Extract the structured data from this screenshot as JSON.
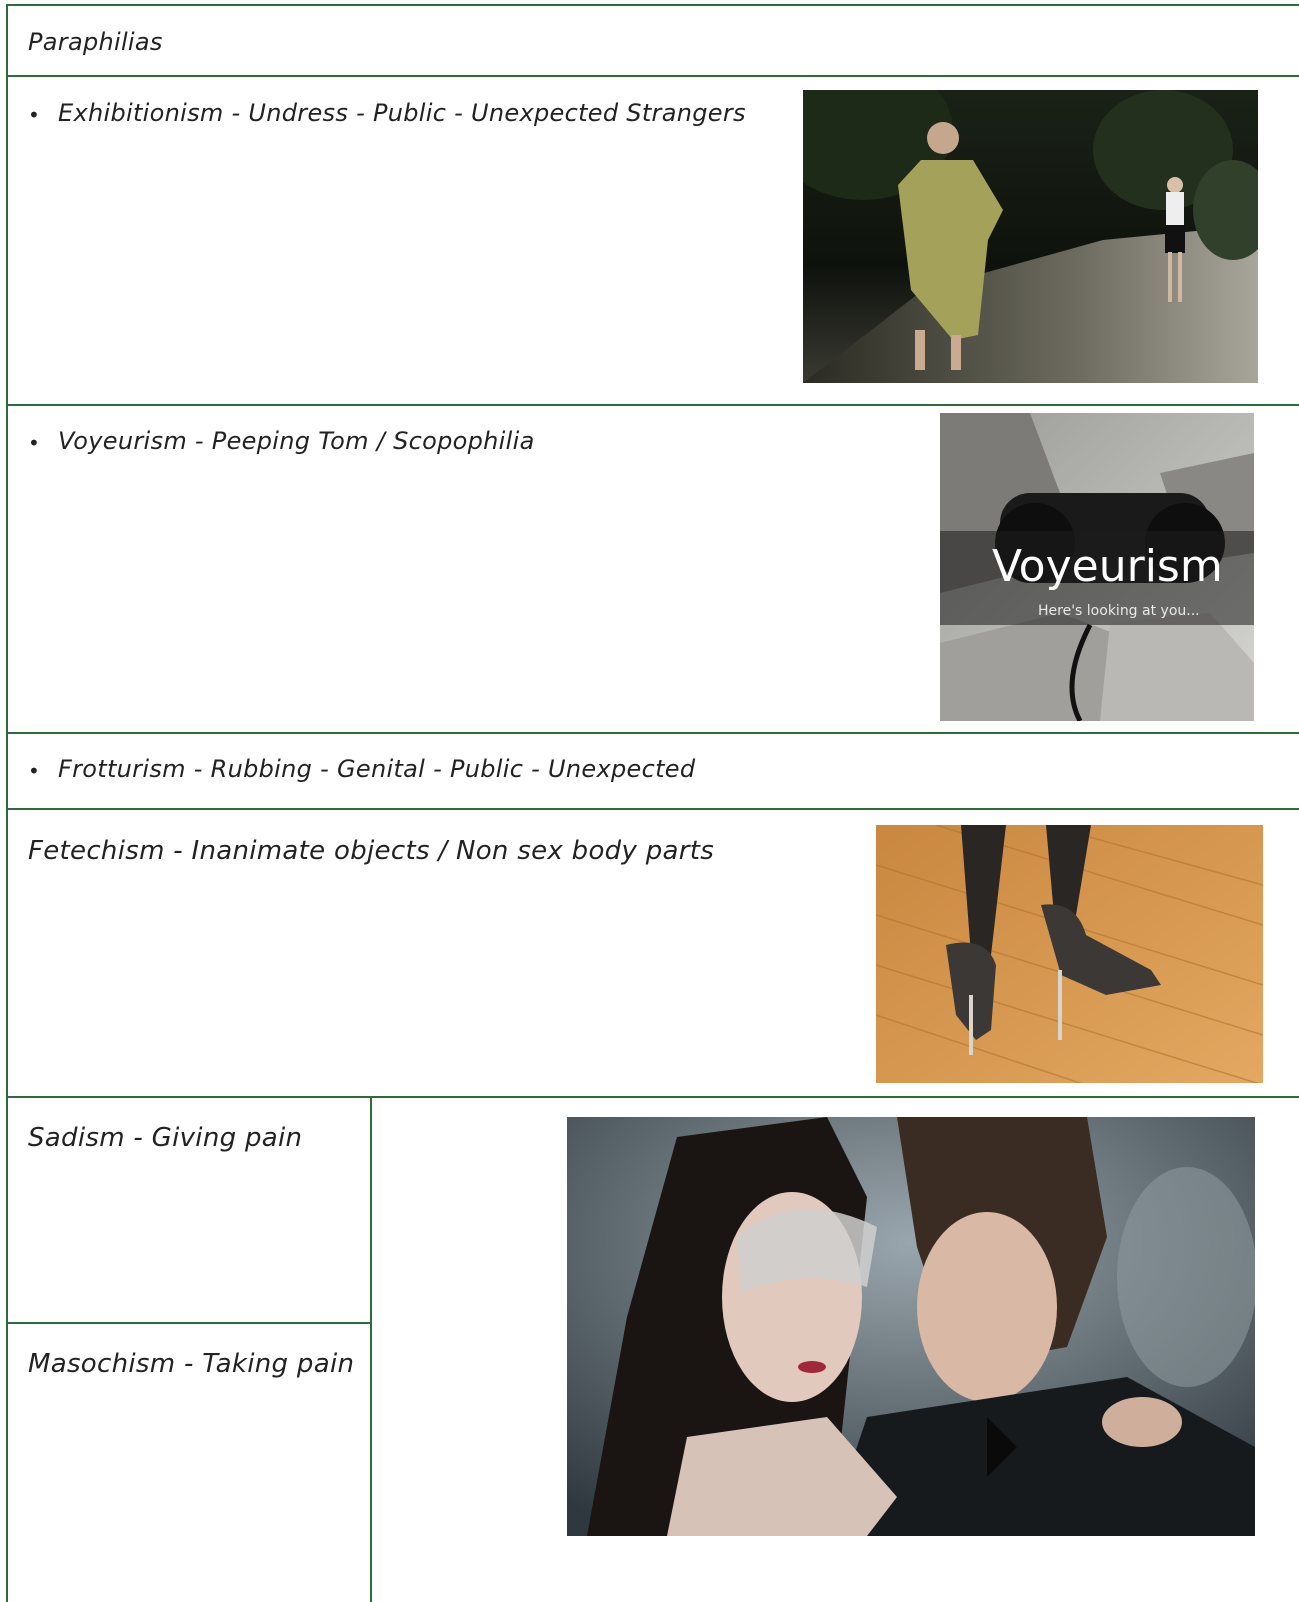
{
  "title": "Paraphilias",
  "rows": [
    {
      "text": "Exhibitionism - Undress - Public - Unexpected Strangers",
      "bullet": "•"
    },
    {
      "text": "Voyeurism - Peeping Tom / Scopophilia",
      "bullet": "•",
      "image_title": "Voyeurism",
      "image_caption": "Here's looking at you..."
    },
    {
      "text": "Frotturism - Rubbing - Genital - Public - Unexpected",
      "bullet": "•"
    },
    {
      "text": "Fetechism - Inanimate objects / Non sex body parts"
    },
    {
      "text": "Sadism - Giving pain"
    },
    {
      "text": "Masochism - Taking pain"
    }
  ],
  "colors": {
    "border": "#2e6b3a",
    "text": "#222222"
  },
  "images": [
    {
      "name": "exhibitionism-photo",
      "description": "man in trench coat on park path"
    },
    {
      "name": "voyeurism-photo",
      "description": "hands holding binoculars"
    },
    {
      "name": "fetishism-photo",
      "description": "legs in stiletto heels on wood floor"
    },
    {
      "name": "sadomasochism-photo",
      "description": "couple, woman wearing lace mask"
    }
  ]
}
